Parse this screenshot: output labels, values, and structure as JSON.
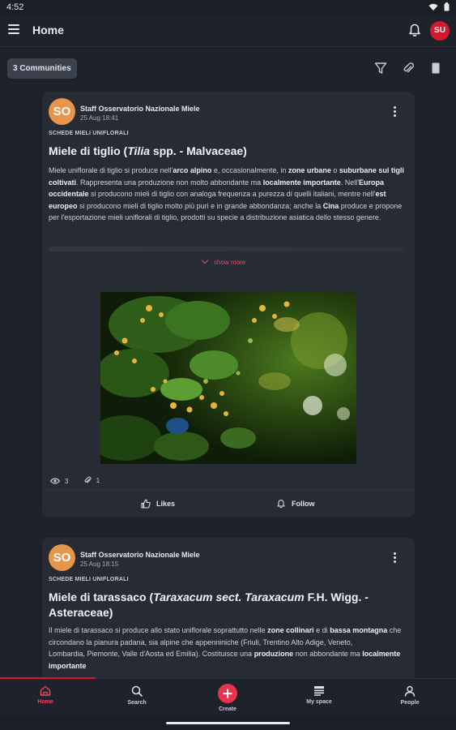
{
  "status_bar": {
    "time": "4:52"
  },
  "appbar": {
    "title": "Home",
    "avatar_initials": "SU"
  },
  "filter": {
    "communities_label": "3 Communities"
  },
  "posts": [
    {
      "avatar_initials": "SO",
      "author": "Staff Osservatorio Nazionale Miele",
      "date": "25 Aug 18:41",
      "category": "SCHEDE MIELI UNIFLORALI",
      "title_parts": [
        "Miele di tiglio (",
        "Tilia",
        " spp. - Malvaceae)"
      ],
      "body_parts": [
        "Miele uniflorale di tiglio si produce nell'",
        "arco alpino",
        " e, occasionalmente, in ",
        "zone urbane",
        " o ",
        "suburbane sui tigli coltivati",
        ". Rappresenta una produzione non molto abbondante ma ",
        "localmente importante",
        ". Nell'",
        "Europa occidentale",
        " si producono mieli di tiglio con analoga frequenza a purezza di quelli italiani, mentre nell'",
        "est europeo",
        " si producono mieli di tiglio molto più puri e in grande abbondanza; anche la ",
        "Cina",
        " produce e propone per l'esportazione mieli uniflorali di tiglio, prodotti su specie a distribuzione asiatica dello stesso genere."
      ],
      "show_more": "show more",
      "views": "3",
      "attachments": "1",
      "like_label": "Likes",
      "follow_label": "Follow"
    },
    {
      "avatar_initials": "SO",
      "author": "Staff Osservatorio Nazionale Miele",
      "date": "25 Aug 18:15",
      "category": "SCHEDE MIELI UNIFLORALI",
      "title_parts": [
        "Miele di tarassaco (",
        "Taraxacum sect. Taraxacum",
        " F.H. Wigg. - Asteraceae)"
      ],
      "body_parts": [
        "Il miele di tarassaco si produce allo stato uniflorale soprattutto nelle ",
        "zone collinari",
        " e di ",
        "bassa montagna",
        " che circondano la pianura padana, sia alpine che appenniniche (Friuli, Trentino Alto Adige, Veneto,",
        "Lombardia, Piemonte, Valle d'Aosta ed Emilia). Costituisce una ",
        "produzione",
        " non abbondante ma ",
        "localmente importante"
      ]
    }
  ],
  "bottom_nav": [
    {
      "label": "Home",
      "icon": "home-icon",
      "active": true
    },
    {
      "label": "Search",
      "icon": "search-icon"
    },
    {
      "label": "Create",
      "icon": "plus-icon"
    },
    {
      "label": "My space",
      "icon": "myspace-icon"
    },
    {
      "label": "People",
      "icon": "person-icon"
    }
  ],
  "colors": {
    "accent": "#d4182e",
    "background": "#1e222b",
    "card": "#262b34",
    "avatar_orange": "#e7954a"
  }
}
